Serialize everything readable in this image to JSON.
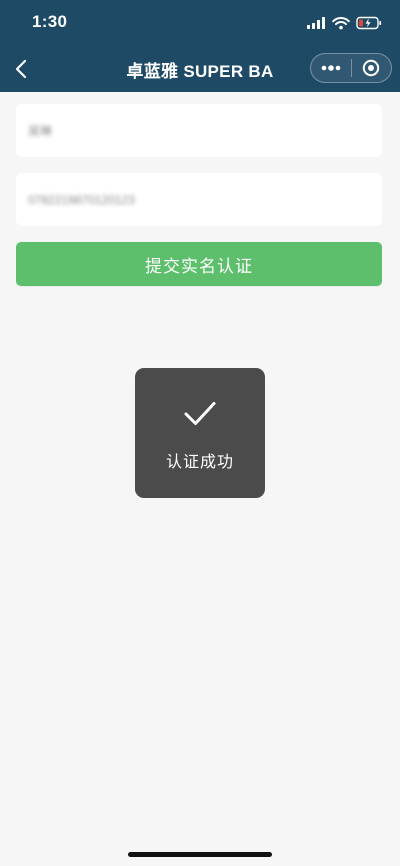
{
  "status_bar": {
    "time": "1:30"
  },
  "nav": {
    "title": "卓蓝雅 SUPER BA",
    "back_icon": "chevron-left-icon",
    "more_icon": "more-dots-icon",
    "close_icon": "target-close-icon"
  },
  "form": {
    "name_value": "吴琳",
    "id_value": "0782219870120123",
    "submit_label": "提交实名认证"
  },
  "toast": {
    "icon": "checkmark-icon",
    "message": "认证成功"
  },
  "colors": {
    "header_bg": "#1f4a66",
    "page_bg": "#f6f6f6",
    "button_bg": "#5dbf6c",
    "toast_bg": "#4b4b4b",
    "battery_low": "#e0463a"
  }
}
